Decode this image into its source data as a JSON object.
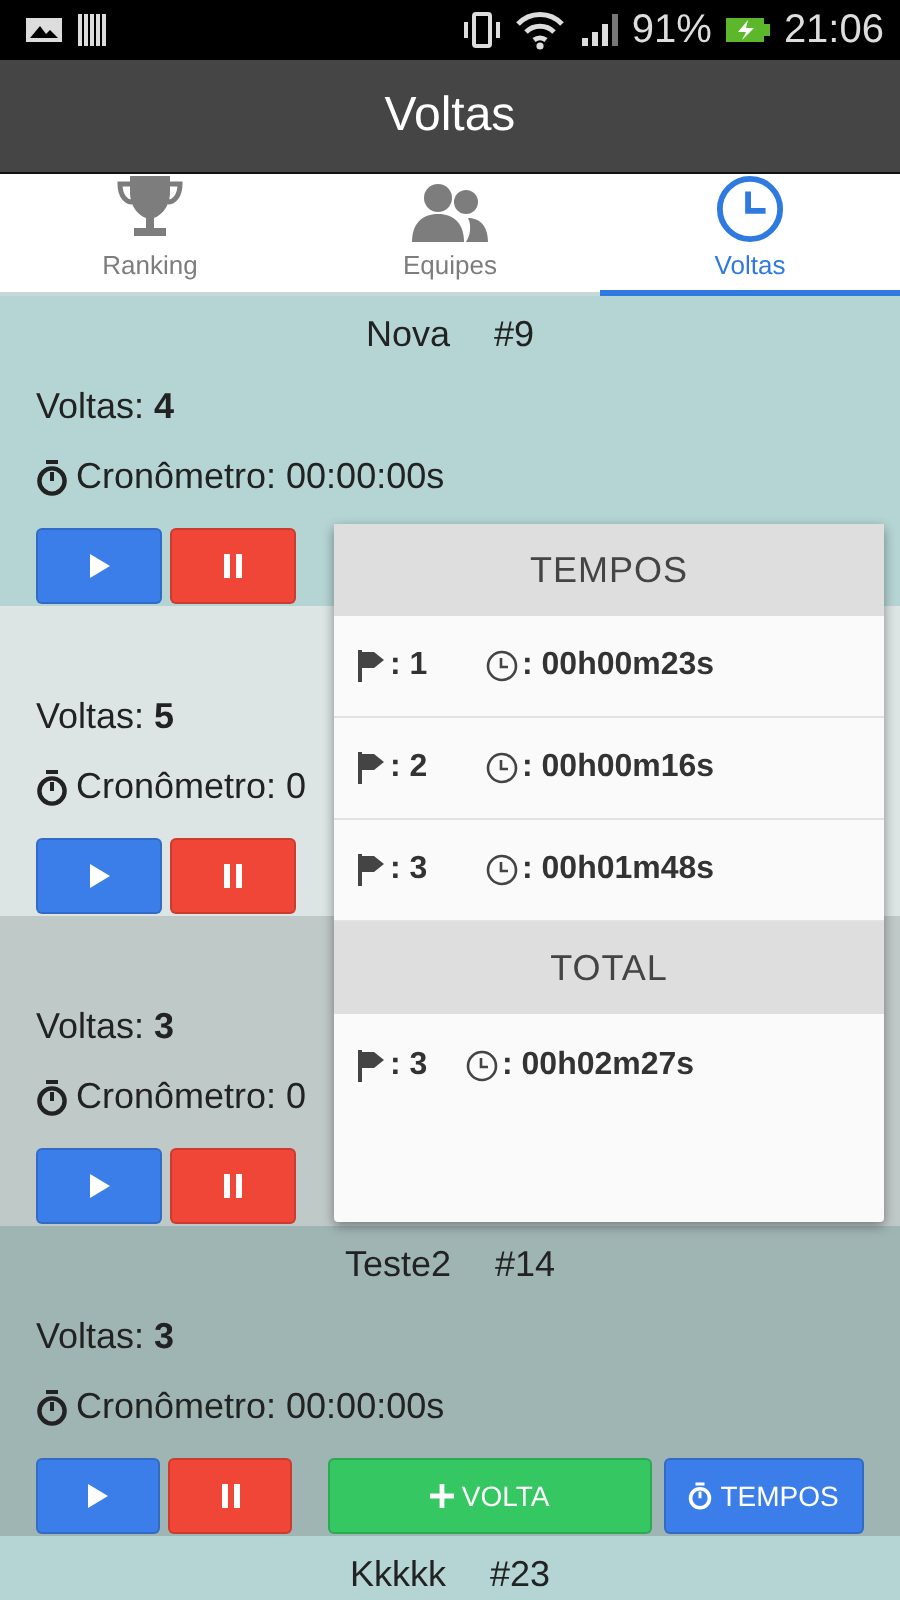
{
  "status_bar": {
    "battery": "91%",
    "time": "21:06"
  },
  "title": "Voltas",
  "tabs": [
    {
      "label": "Ranking",
      "kind": "trophy",
      "selected": false
    },
    {
      "label": "Equipes",
      "kind": "people",
      "selected": false
    },
    {
      "label": "Voltas",
      "kind": "clock",
      "selected": true
    }
  ],
  "cards": [
    {
      "name": "Nova",
      "number": "#9",
      "laps": "Voltas: **4**",
      "timer": "Cronômetro: 00:00:00s",
      "buttons": [
        {
          "kind": "play"
        },
        {
          "kind": "pause"
        }
      ]
    },
    {
      "laps": "Voltas: **5**",
      "timer": "Cronômetro: 0",
      "buttons": [
        {
          "kind": "play"
        },
        {
          "kind": "pause"
        }
      ]
    },
    {
      "laps": "Voltas: **3**",
      "timer": "Cronômetro: 0",
      "buttons": [
        {
          "kind": "play"
        },
        {
          "kind": "pause"
        }
      ]
    },
    {
      "name": "Teste2",
      "number": "#14",
      "laps": "Voltas: **3**",
      "timer": "Cronômetro: 00:00:00s",
      "buttons": [
        {
          "kind": "play"
        },
        {
          "kind": "pause"
        },
        {
          "kind": "lap",
          "label": "VOLTA"
        },
        {
          "kind": "times",
          "label": "TEMPOS"
        }
      ]
    },
    {
      "name": "Kkkkk",
      "number": "#23"
    }
  ],
  "popup": {
    "title": "TEMPOS",
    "laps": [
      {
        "lap": ": 1",
        "time": ": 00h00m23s"
      },
      {
        "lap": ": 2",
        "time": ": 00h00m16s"
      },
      {
        "lap": ": 3",
        "time": ": 00h01m48s"
      }
    ],
    "total_title": "TOTAL",
    "total": {
      "lap": ": 3",
      "time": ": 00h02m27s"
    }
  }
}
